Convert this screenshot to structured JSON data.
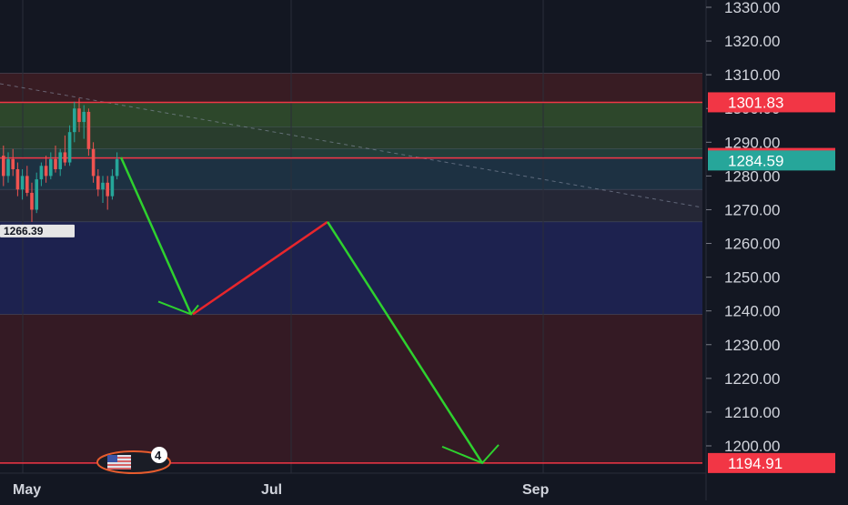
{
  "chart_data": {
    "type": "candlestick",
    "y_axis": {
      "ticks": [
        "1330.00",
        "1320.00",
        "1310.00",
        "1300.00",
        "1290.00",
        "1280.00",
        "1270.00",
        "1260.00",
        "1250.00",
        "1240.00",
        "1230.00",
        "1220.00",
        "1210.00",
        "1200.00"
      ],
      "tick_values": [
        1330,
        1320,
        1310,
        1300,
        1290,
        1280,
        1270,
        1260,
        1250,
        1240,
        1230,
        1220,
        1210,
        1200
      ],
      "range": [
        1193,
        1333
      ]
    },
    "x_axis": {
      "ticks": [
        "May",
        "Jul",
        "Sep"
      ]
    },
    "price_labels": [
      {
        "text": "1301.83",
        "value": 1301.83,
        "color": "#f23645"
      },
      {
        "text": "1285.34",
        "value": 1285.34,
        "color": "#f23645"
      },
      {
        "text": "1284.59",
        "value": 1284.59,
        "color": "#26a69a"
      },
      {
        "text": "1194.91",
        "value": 1194.91,
        "color": "#f23645"
      }
    ],
    "low_label": {
      "text": "1266.39",
      "value": 1266.39
    },
    "zones": [
      {
        "from": 1301.83,
        "to": 1310.5,
        "color": "#3a1c24"
      },
      {
        "from": 1294.5,
        "to": 1301.83,
        "color": "#2e4a2c"
      },
      {
        "from": 1288.0,
        "to": 1294.5,
        "color": "#2a3f2e"
      },
      {
        "from": 1285.5,
        "to": 1288.0,
        "color": "#23403c"
      },
      {
        "from": 1276.0,
        "to": 1285.5,
        "color": "#1e3345"
      },
      {
        "from": 1266.39,
        "to": 1276.0,
        "color": "#262838"
      },
      {
        "from": 1239.0,
        "to": 1266.39,
        "color": "#1e2352"
      },
      {
        "from": 1194.91,
        "to": 1239.0,
        "color": "#361a25"
      }
    ],
    "candles": [
      {
        "o": 1286,
        "h": 1289,
        "l": 1277,
        "c": 1280
      },
      {
        "o": 1280,
        "h": 1287,
        "l": 1278,
        "c": 1285
      },
      {
        "o": 1285,
        "h": 1288,
        "l": 1280,
        "c": 1282
      },
      {
        "o": 1282,
        "h": 1284,
        "l": 1274,
        "c": 1276
      },
      {
        "o": 1276,
        "h": 1282,
        "l": 1273,
        "c": 1280
      },
      {
        "o": 1280,
        "h": 1283,
        "l": 1274,
        "c": 1275
      },
      {
        "o": 1275,
        "h": 1278,
        "l": 1266.39,
        "c": 1270
      },
      {
        "o": 1270,
        "h": 1281,
        "l": 1269,
        "c": 1279
      },
      {
        "o": 1279,
        "h": 1284,
        "l": 1277,
        "c": 1283
      },
      {
        "o": 1283,
        "h": 1286,
        "l": 1278,
        "c": 1280
      },
      {
        "o": 1280,
        "h": 1287,
        "l": 1279,
        "c": 1285
      },
      {
        "o": 1285,
        "h": 1289,
        "l": 1281,
        "c": 1282
      },
      {
        "o": 1282,
        "h": 1288,
        "l": 1280,
        "c": 1287
      },
      {
        "o": 1287,
        "h": 1292,
        "l": 1283,
        "c": 1284
      },
      {
        "o": 1284,
        "h": 1295,
        "l": 1283,
        "c": 1293
      },
      {
        "o": 1293,
        "h": 1302,
        "l": 1290,
        "c": 1300
      },
      {
        "o": 1300,
        "h": 1303,
        "l": 1293,
        "c": 1296
      },
      {
        "o": 1296,
        "h": 1301,
        "l": 1291,
        "c": 1299
      },
      {
        "o": 1299,
        "h": 1300,
        "l": 1286,
        "c": 1288
      },
      {
        "o": 1288,
        "h": 1290,
        "l": 1278,
        "c": 1280
      },
      {
        "o": 1280,
        "h": 1282,
        "l": 1274,
        "c": 1276
      },
      {
        "o": 1276,
        "h": 1280,
        "l": 1272,
        "c": 1278
      },
      {
        "o": 1278,
        "h": 1280,
        "l": 1270,
        "c": 1274
      },
      {
        "o": 1274,
        "h": 1282,
        "l": 1273,
        "c": 1280
      },
      {
        "o": 1280,
        "h": 1287,
        "l": 1279,
        "c": 1285
      }
    ],
    "projection_path": [
      {
        "label": "start",
        "value": 1285.5
      },
      {
        "label": "low-1",
        "value": 1239
      },
      {
        "label": "high-1",
        "value": 1266.4
      },
      {
        "label": "target",
        "value": 1194.91
      }
    ],
    "colors": {
      "up": "#26a69a",
      "down": "#ef5350",
      "arrow_down": "#2ed12e",
      "arrow_up": "#e8262c",
      "level_line": "#f23645",
      "grid": "#2a2e39"
    }
  },
  "badge": {
    "count": "4"
  }
}
